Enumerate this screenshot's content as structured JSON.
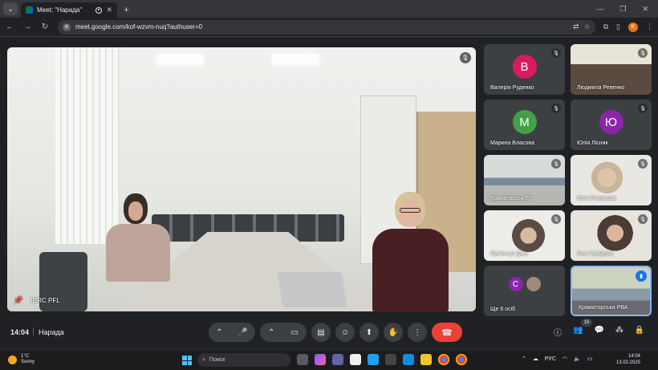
{
  "browser": {
    "tab_title": "Meet: \"Нарада\"",
    "new_tab_symbol": "+",
    "url": "meet.google.com/kof-wzvm-nuq?authuser=0",
    "profile_initial": "K"
  },
  "main_video": {
    "participant_label": "ICRC PFL"
  },
  "tiles": [
    {
      "name": "Валерія Руденко",
      "initial": "В",
      "color": "#d81b60"
    },
    {
      "name": "Людмила Ревенко"
    },
    {
      "name": "Марина Власова",
      "initial": "М",
      "color": "#43a047"
    },
    {
      "name": "Юлія Лісняк",
      "initial": "Ю",
      "color": "#8e24aa"
    },
    {
      "name": "Краматорськ ТГ"
    },
    {
      "name": "Юля Романова"
    },
    {
      "name": "Лук'янчук Діна"
    },
    {
      "name": "Яна Говядова"
    },
    {
      "name": "Ще 6 осіб",
      "initial": "С",
      "color": "#8e24aa"
    },
    {
      "name": "Краматорська РВА"
    }
  ],
  "meeting": {
    "time": "14:04",
    "title": "Нарада",
    "participant_count": "16"
  },
  "taskbar": {
    "temperature": "1°C",
    "weather": "Sunny",
    "search_placeholder": "Поиск",
    "language": "РУС",
    "time": "14:04",
    "date": "13.02.2025"
  },
  "colors": {
    "end_call": "#ea4335",
    "active_speaker_border": "#8ab4f8",
    "accent": "#1a73e8"
  }
}
